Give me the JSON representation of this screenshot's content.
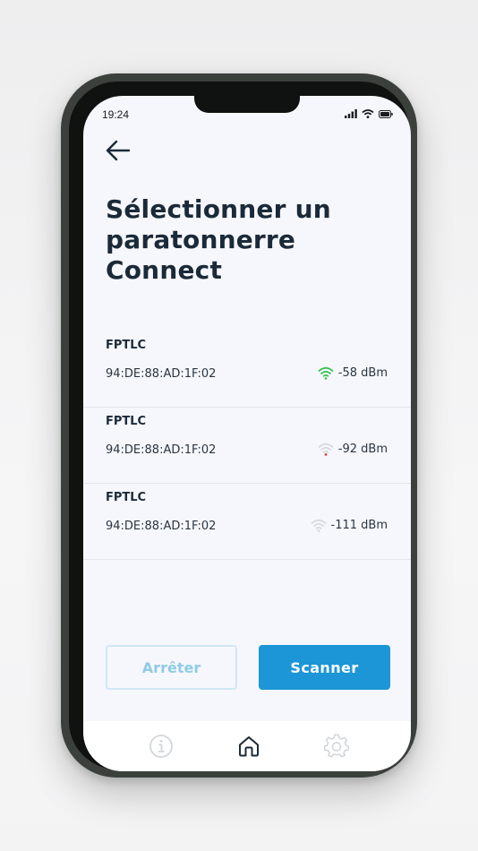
{
  "status_bar": {
    "time": "19:24",
    "icons": [
      "cellular-icon",
      "wifi-icon",
      "battery-icon"
    ]
  },
  "header": {
    "back_icon": "arrow-left-icon",
    "title": "Sélectionner un paratonnerre Connect"
  },
  "devices": [
    {
      "name": "FPTLC",
      "mac": "94:DE:88:AD:1F:02",
      "rssi": "-58 dBm",
      "signal_color": "#2fbf4f",
      "signal_level": "strong"
    },
    {
      "name": "FPTLC",
      "mac": "94:DE:88:AD:1F:02",
      "rssi": "-92 dBm",
      "signal_color": "#e03a3a",
      "signal_level": "weak"
    },
    {
      "name": "FPTLC",
      "mac": "94:DE:88:AD:1F:02",
      "rssi": "-111 dBm",
      "signal_color": "#cfd3da",
      "signal_level": "none"
    }
  ],
  "actions": {
    "stop_label": "Arrêter",
    "scan_label": "Scanner"
  },
  "tabbar": {
    "items": [
      "info-icon",
      "home-icon",
      "gear-icon"
    ],
    "active": "home-icon"
  },
  "colors": {
    "accent": "#1c96d6",
    "title": "#1b2a38",
    "background": "#f6f7fd"
  }
}
